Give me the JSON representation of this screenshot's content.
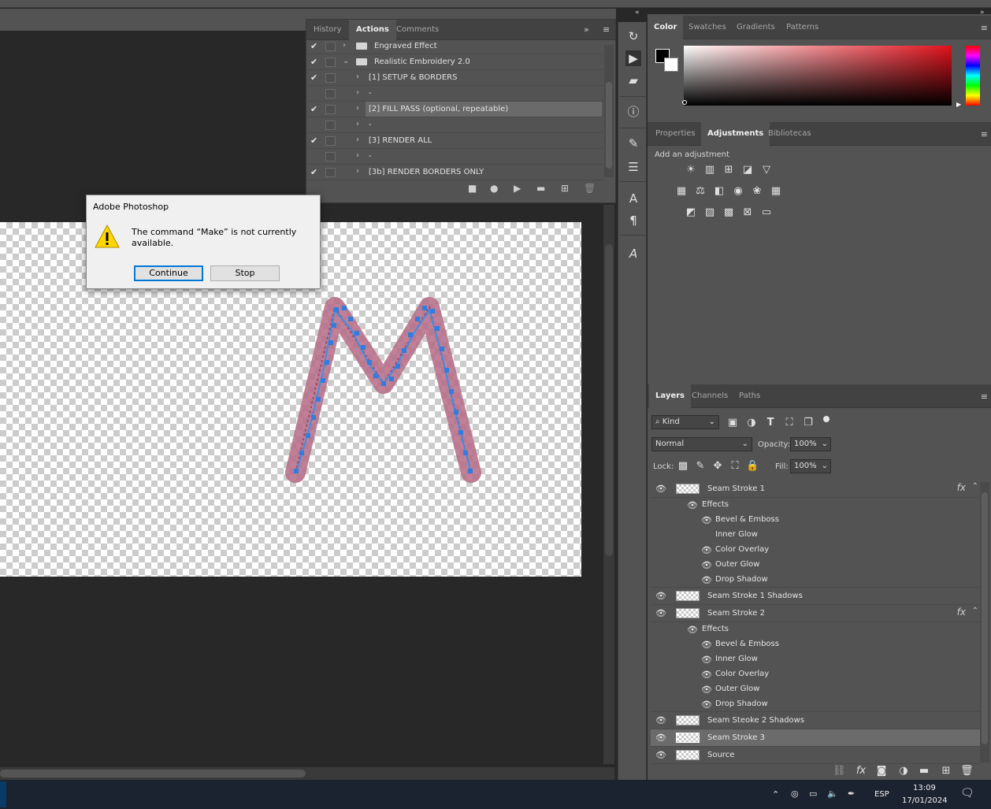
{
  "actions_panel": {
    "tabs": [
      "History",
      "Actions",
      "Comments"
    ],
    "active_tab": "Actions",
    "rows": [
      {
        "label": "Engraved Effect",
        "checked": true,
        "type": "set",
        "expanded": false
      },
      {
        "label": "Realistic Embroidery 2.0",
        "checked": true,
        "type": "set",
        "expanded": true
      },
      {
        "label": "[1] SETUP & BORDERS",
        "checked": true,
        "type": "action"
      },
      {
        "label": "-",
        "checked": false,
        "type": "action"
      },
      {
        "label": "[2] FILL PASS (optional, repeatable)",
        "checked": true,
        "type": "action",
        "selected": true
      },
      {
        "label": "-",
        "checked": false,
        "type": "action"
      },
      {
        "label": "[3] RENDER ALL",
        "checked": true,
        "type": "action"
      },
      {
        "label": "-",
        "checked": false,
        "type": "action"
      },
      {
        "label": "[3b] RENDER BORDERS ONLY",
        "checked": true,
        "type": "action"
      }
    ]
  },
  "dialog": {
    "title": "Adobe Photoshop",
    "message": "The command “Make” is not currently available.",
    "continue_label": "Continue",
    "stop_label": "Stop"
  },
  "color_panel": {
    "tabs": [
      "Color",
      "Swatches",
      "Gradients",
      "Patterns"
    ],
    "active_tab": "Color",
    "foreground": "#000000",
    "background": "#ffffff",
    "hue_color": "#e0121c"
  },
  "adjustments_panel": {
    "tabs": [
      "Properties",
      "Adjustments",
      "Bibliotecas"
    ],
    "active_tab": "Adjustments",
    "heading": "Add an adjustment"
  },
  "layers_panel": {
    "tabs": [
      "Layers",
      "Channels",
      "Paths"
    ],
    "active_tab": "Layers",
    "kind_label": "Kind",
    "blend_mode": "Normal",
    "opacity_label": "Opacity:",
    "opacity": "100%",
    "lock_label": "Lock:",
    "fill_label": "Fill:",
    "fill": "100%",
    "effects_label": "Effects",
    "layers": [
      {
        "name": "Seam Stroke 1",
        "fx": true,
        "effects": [
          {
            "name": "Bevel & Emboss",
            "visible": true
          },
          {
            "name": "Inner Glow",
            "visible": false
          },
          {
            "name": "Color Overlay",
            "visible": true
          },
          {
            "name": "Outer Glow",
            "visible": true
          },
          {
            "name": "Drop Shadow",
            "visible": true
          }
        ]
      },
      {
        "name": "Seam Stroke 1 Shadows",
        "fx": false
      },
      {
        "name": "Seam Stroke 2",
        "fx": true,
        "effects": [
          {
            "name": "Bevel & Emboss",
            "visible": true
          },
          {
            "name": "Inner Glow",
            "visible": true
          },
          {
            "name": "Color Overlay",
            "visible": true
          },
          {
            "name": "Outer Glow",
            "visible": true
          },
          {
            "name": "Drop Shadow",
            "visible": true
          }
        ]
      },
      {
        "name": "Seam Steoke 2 Shadows",
        "fx": false
      },
      {
        "name": "Seam Stroke 3",
        "fx": false,
        "selected": true
      },
      {
        "name": "Source",
        "fx": false
      }
    ]
  },
  "taskbar": {
    "language": "ESP",
    "time": "13:09",
    "date": "17/01/2024"
  },
  "canvas": {
    "letter": "M",
    "stroke_color": "#c06080",
    "stitch_color": "#3d8ee6"
  }
}
